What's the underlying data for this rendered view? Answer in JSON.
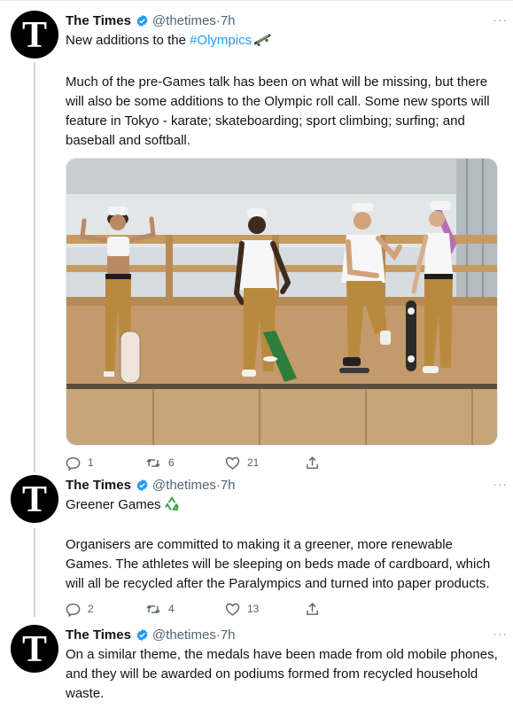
{
  "tweets": [
    {
      "name": "The Times",
      "handle": "@thetimes",
      "time": "7h",
      "line1_prefix": "New additions to the ",
      "hashtag": "#Olympics",
      "body": "Much of the pre-Games talk has been on what will be missing, but there will also be some additions to the Olympic roll call. Some new sports will feature in Tokyo - karate; skateboarding; sport climbing; surfing; and baseball and softball.",
      "emoji": "skateboard-icon",
      "replies": "1",
      "retweets": "6",
      "likes": "21"
    },
    {
      "name": "The Times",
      "handle": "@thetimes",
      "time": "7h",
      "line1": "Greener Games",
      "emoji": "recycle-icon",
      "body": "Organisers are committed to making it a greener, more renewable Games. The athletes will be sleeping on beds made of cardboard, which will all be recycled after the Paralympics and turned into paper products.",
      "replies": "2",
      "retweets": "4",
      "likes": "13"
    },
    {
      "name": "The Times",
      "handle": "@thetimes",
      "time": "7h",
      "body": "On a similar theme, the medals have been made from old mobile phones, and they will be awarded on podiums formed from recycled household waste."
    }
  ],
  "avatar_letter": "T",
  "separator": "·",
  "more_label": "···",
  "colors": {
    "link": "#1d9bf0",
    "muted": "#536471",
    "verified": "#1d9bf0"
  }
}
